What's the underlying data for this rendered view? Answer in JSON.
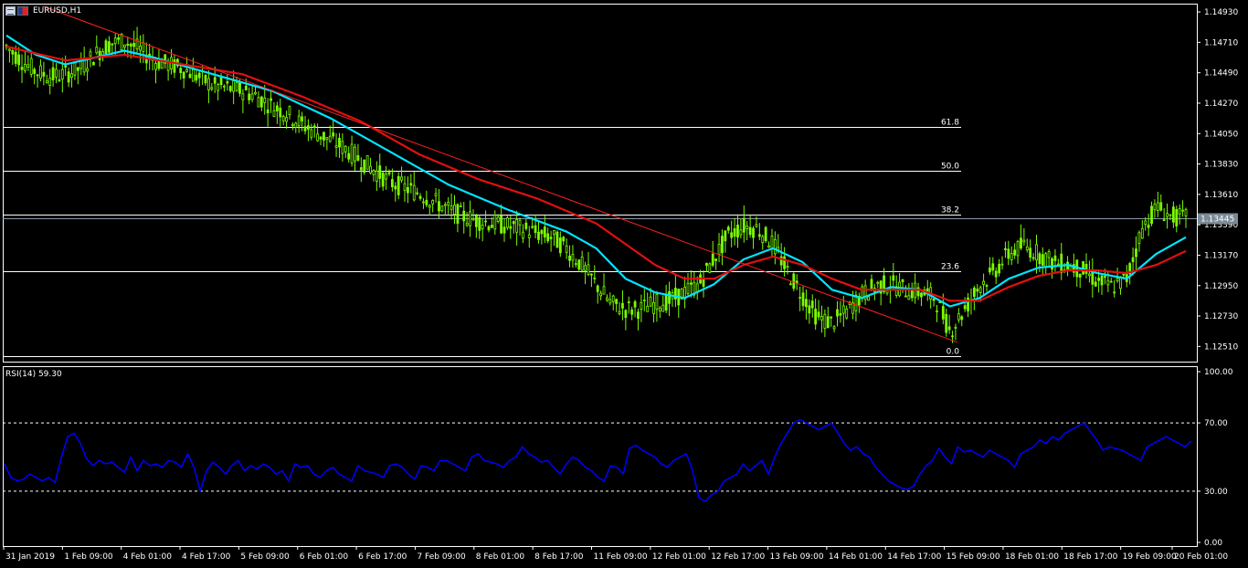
{
  "window": {
    "symbol_title": "EURUSD,H1",
    "icon_menu": "chart-menu-icon",
    "icon_flag": "currency-flag-icon"
  },
  "indicator": {
    "label": "RSI(14) 59.30",
    "level_high": 70,
    "level_low": 30
  },
  "price": {
    "current": "1.13445",
    "current_value": 1.13445
  },
  "colors": {
    "background": "#000000",
    "candle": "#7CFC00",
    "ma_fast": "#00E5FF",
    "ma_slow": "#E01010",
    "trendline": "#FF2020",
    "fib": "#FFFFFF",
    "rsi": "#0000FF",
    "axis": "#FFFFFF"
  },
  "chart_data": [
    {
      "type": "candlestick",
      "name_shown": "EURUSD,H1",
      "ylim": [
        1.124,
        1.1499
      ],
      "y_ticks": [
        "1.14930",
        "1.14710",
        "1.14490",
        "1.14270",
        "1.14050",
        "1.13830",
        "1.13610",
        "1.13390",
        "1.13170",
        "1.12950",
        "1.12730",
        "1.12510"
      ],
      "x_ticks": [
        "31 Jan 2019",
        "1 Feb 09:00",
        "4 Feb 01:00",
        "4 Feb 17:00",
        "5 Feb 09:00",
        "6 Feb 01:00",
        "6 Feb 17:00",
        "7 Feb 09:00",
        "8 Feb 01:00",
        "8 Feb 17:00",
        "11 Feb 09:00",
        "12 Feb 01:00",
        "12 Feb 17:00",
        "13 Feb 09:00",
        "14 Feb 01:00",
        "14 Feb 17:00",
        "15 Feb 09:00",
        "18 Feb 01:00",
        "18 Feb 17:00",
        "19 Feb 09:00",
        "20 Feb 01:00"
      ],
      "close_path": [
        [
          0,
          1.1468
        ],
        [
          1,
          1.1458
        ],
        [
          2,
          1.145
        ],
        [
          3,
          1.1446
        ],
        [
          4,
          1.1448
        ],
        [
          5,
          1.1452
        ],
        [
          6,
          1.1462
        ],
        [
          7,
          1.147
        ],
        [
          8,
          1.1472
        ],
        [
          9,
          1.1466
        ],
        [
          10,
          1.1458
        ],
        [
          11,
          1.1455
        ],
        [
          12,
          1.1452
        ],
        [
          13,
          1.1446
        ],
        [
          14,
          1.144
        ],
        [
          15,
          1.1438
        ],
        [
          16,
          1.1436
        ],
        [
          17,
          1.1432
        ],
        [
          18,
          1.1425
        ],
        [
          19,
          1.142
        ],
        [
          20,
          1.1412
        ],
        [
          21,
          1.1406
        ],
        [
          22,
          1.14
        ],
        [
          23,
          1.1394
        ],
        [
          24,
          1.1386
        ],
        [
          25,
          1.1378
        ],
        [
          26,
          1.137
        ],
        [
          27,
          1.1366
        ],
        [
          28,
          1.1362
        ],
        [
          29,
          1.1356
        ],
        [
          30,
          1.135
        ],
        [
          31,
          1.1345
        ],
        [
          32,
          1.1342
        ],
        [
          33,
          1.134
        ],
        [
          34,
          1.1338
        ],
        [
          35,
          1.1336
        ],
        [
          36,
          1.1333
        ],
        [
          37,
          1.133
        ],
        [
          38,
          1.1322
        ],
        [
          39,
          1.131
        ],
        [
          40,
          1.1296
        ],
        [
          41,
          1.1282
        ],
        [
          42,
          1.1278
        ],
        [
          43,
          1.1278
        ],
        [
          44,
          1.1282
        ],
        [
          45,
          1.1284
        ],
        [
          46,
          1.129
        ],
        [
          47,
          1.1296
        ],
        [
          48,
          1.1315
        ],
        [
          49,
          1.1332
        ],
        [
          50,
          1.1338
        ],
        [
          51,
          1.1336
        ],
        [
          52,
          1.1325
        ],
        [
          53,
          1.1305
        ],
        [
          54,
          1.1288
        ],
        [
          55,
          1.1272
        ],
        [
          56,
          1.1268
        ],
        [
          57,
          1.1276
        ],
        [
          58,
          1.1288
        ],
        [
          59,
          1.1295
        ],
        [
          60,
          1.1296
        ],
        [
          61,
          1.1292
        ],
        [
          62,
          1.129
        ],
        [
          63,
          1.1286
        ],
        [
          64,
          1.1262
        ],
        [
          65,
          1.1278
        ],
        [
          66,
          1.1295
        ],
        [
          67,
          1.1305
        ],
        [
          68,
          1.1318
        ],
        [
          69,
          1.1324
        ],
        [
          70,
          1.1318
        ],
        [
          71,
          1.1312
        ],
        [
          72,
          1.131
        ],
        [
          73,
          1.1306
        ],
        [
          74,
          1.1298
        ],
        [
          75,
          1.1294
        ],
        [
          76,
          1.13
        ],
        [
          77,
          1.1335
        ],
        [
          78,
          1.1352
        ],
        [
          79,
          1.1345
        ],
        [
          80,
          1.1344
        ]
      ],
      "overlays": [
        {
          "type": "line",
          "role": "ma_fast",
          "points": [
            [
              0,
              1.1476
            ],
            [
              2,
              1.1462
            ],
            [
              4,
              1.1455
            ],
            [
              6,
              1.146
            ],
            [
              8,
              1.1465
            ],
            [
              10,
              1.146
            ],
            [
              14,
              1.1448
            ],
            [
              18,
              1.1436
            ],
            [
              22,
              1.1416
            ],
            [
              26,
              1.1392
            ],
            [
              30,
              1.1368
            ],
            [
              34,
              1.135
            ],
            [
              38,
              1.1334
            ],
            [
              40,
              1.1322
            ],
            [
              42,
              1.13
            ],
            [
              44,
              1.129
            ],
            [
              46,
              1.1286
            ],
            [
              48,
              1.1296
            ],
            [
              50,
              1.1314
            ],
            [
              52,
              1.1322
            ],
            [
              54,
              1.1312
            ],
            [
              56,
              1.1292
            ],
            [
              58,
              1.1286
            ],
            [
              60,
              1.1294
            ],
            [
              62,
              1.1292
            ],
            [
              64,
              1.128
            ],
            [
              66,
              1.1286
            ],
            [
              68,
              1.13
            ],
            [
              70,
              1.1308
            ],
            [
              72,
              1.131
            ],
            [
              74,
              1.1304
            ],
            [
              76,
              1.13
            ],
            [
              78,
              1.1318
            ],
            [
              80,
              1.133
            ]
          ]
        },
        {
          "type": "line",
          "role": "ma_slow",
          "points": [
            [
              0,
              1.1468
            ],
            [
              4,
              1.1458
            ],
            [
              6,
              1.146
            ],
            [
              8,
              1.1462
            ],
            [
              12,
              1.1455
            ],
            [
              16,
              1.1448
            ],
            [
              20,
              1.1432
            ],
            [
              24,
              1.1414
            ],
            [
              28,
              1.139
            ],
            [
              32,
              1.1372
            ],
            [
              36,
              1.1358
            ],
            [
              40,
              1.134
            ],
            [
              42,
              1.1325
            ],
            [
              44,
              1.131
            ],
            [
              46,
              1.13
            ],
            [
              48,
              1.13
            ],
            [
              50,
              1.131
            ],
            [
              52,
              1.1316
            ],
            [
              54,
              1.131
            ],
            [
              56,
              1.13
            ],
            [
              58,
              1.1292
            ],
            [
              60,
              1.1292
            ],
            [
              62,
              1.1292
            ],
            [
              64,
              1.1284
            ],
            [
              66,
              1.1284
            ],
            [
              68,
              1.1294
            ],
            [
              70,
              1.1302
            ],
            [
              72,
              1.1306
            ],
            [
              74,
              1.1306
            ],
            [
              76,
              1.1304
            ],
            [
              78,
              1.131
            ],
            [
              80,
              1.132
            ]
          ]
        },
        {
          "type": "trendline",
          "from": [
            2.5,
            1.1497
          ],
          "to": [
            64.5,
            1.1254
          ]
        }
      ],
      "fib_levels": [
        {
          "label": "61.8",
          "value": 1.141
        },
        {
          "label": "50.0",
          "value": 1.1378
        },
        {
          "label": "38.2",
          "value": 1.13465
        },
        {
          "label": "23.6",
          "value": 1.13055
        },
        {
          "label": "0.0",
          "value": 1.1244
        }
      ]
    },
    {
      "type": "line",
      "name_shown": "RSI(14) 59.30",
      "ylim": [
        0,
        100
      ],
      "y_ticks": [
        "100.00",
        "70.00",
        "30.00",
        "0.00"
      ],
      "levels": [
        70,
        30
      ],
      "values": [
        46,
        38,
        36,
        37,
        40,
        38,
        36,
        38,
        35,
        50,
        62,
        64,
        58,
        49,
        45,
        48,
        46,
        47,
        44,
        41,
        50,
        42,
        48,
        45,
        46,
        44,
        48,
        47,
        44,
        52,
        44,
        30,
        42,
        47,
        44,
        40,
        45,
        48,
        42,
        45,
        43,
        46,
        44,
        40,
        42,
        36,
        46,
        44,
        45,
        40,
        38,
        42,
        44,
        40,
        38,
        36,
        45,
        42,
        41,
        40,
        38,
        45,
        46,
        44,
        40,
        37,
        45,
        44,
        42,
        48,
        48,
        46,
        44,
        42,
        50,
        52,
        48,
        47,
        46,
        44,
        48,
        50,
        56,
        52,
        50,
        47,
        48,
        44,
        40,
        46,
        50,
        48,
        44,
        42,
        38,
        36,
        45,
        44,
        40,
        55,
        57,
        54,
        52,
        50,
        46,
        44,
        48,
        50,
        52,
        42,
        26,
        24,
        28,
        30,
        36,
        38,
        40,
        46,
        42,
        45,
        48,
        40,
        50,
        58,
        64,
        70,
        72,
        70,
        68,
        66,
        68,
        70,
        64,
        58,
        54,
        56,
        52,
        50,
        44,
        40,
        36,
        34,
        32,
        31,
        33,
        40,
        45,
        48,
        55,
        50,
        46,
        56,
        53,
        54,
        52,
        50,
        54,
        52,
        50,
        48,
        44,
        52,
        54,
        56,
        60,
        58,
        62,
        60,
        64,
        66,
        68,
        70,
        65,
        60,
        54,
        56,
        55,
        54,
        52,
        50,
        48,
        56,
        58,
        60,
        62,
        60,
        58,
        56,
        59.3
      ]
    }
  ]
}
